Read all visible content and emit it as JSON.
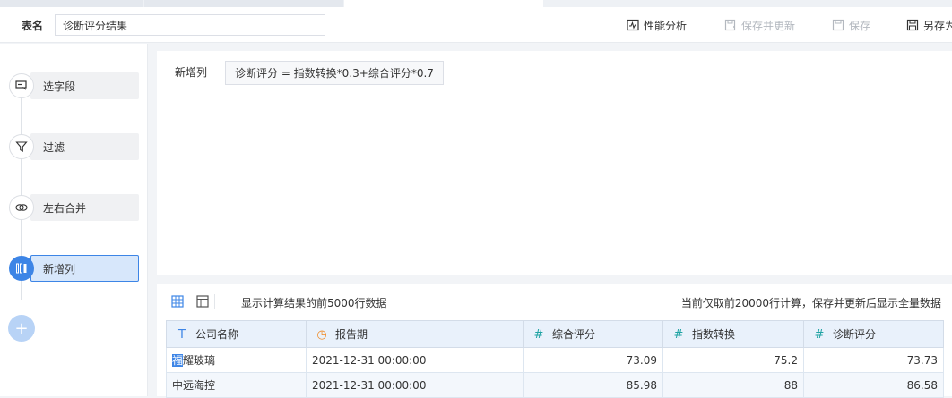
{
  "header": {
    "table_name_label": "表名",
    "table_name_value": "诊断评分结果",
    "actions": {
      "performance": "性能分析",
      "save_update": "保存并更新",
      "save": "保存",
      "save_as": "另存为"
    }
  },
  "steps": [
    {
      "label": "选字段",
      "icon": "select-field-icon"
    },
    {
      "label": "过滤",
      "icon": "filter-icon"
    },
    {
      "label": "左右合并",
      "icon": "merge-icon"
    },
    {
      "label": "新增列",
      "icon": "add-column-icon"
    }
  ],
  "panel": {
    "label": "新增列",
    "formula": "诊断评分 = 指数转换*0.3+综合评分*0.7"
  },
  "result": {
    "left_text": "显示计算结果的前5000行数据",
    "right_text": "当前仅取前20000行计算，保存并更新后显示全量数据",
    "columns": [
      {
        "name": "公司名称",
        "type_icon": "T"
      },
      {
        "name": "报告期",
        "type_icon": "◷"
      },
      {
        "name": "综合评分",
        "type_icon": "#"
      },
      {
        "name": "指数转换",
        "type_icon": "#"
      },
      {
        "name": "诊断评分",
        "type_icon": "#"
      }
    ],
    "rows": [
      {
        "company_hl": "福",
        "company_rest": "耀玻璃",
        "date": "2021-12-31 00:00:00",
        "score": "73.09",
        "index": "75.2",
        "diag": "73.73"
      },
      {
        "company_hl": "",
        "company_rest": "中远海控",
        "date": "2021-12-31 00:00:00",
        "score": "85.98",
        "index": "88",
        "diag": "86.58"
      }
    ]
  },
  "colors": {
    "accent": "#3d85e6",
    "disabled": "#b3b8bf",
    "number_icon": "#1fa3a3",
    "date_icon": "#f08a24"
  }
}
